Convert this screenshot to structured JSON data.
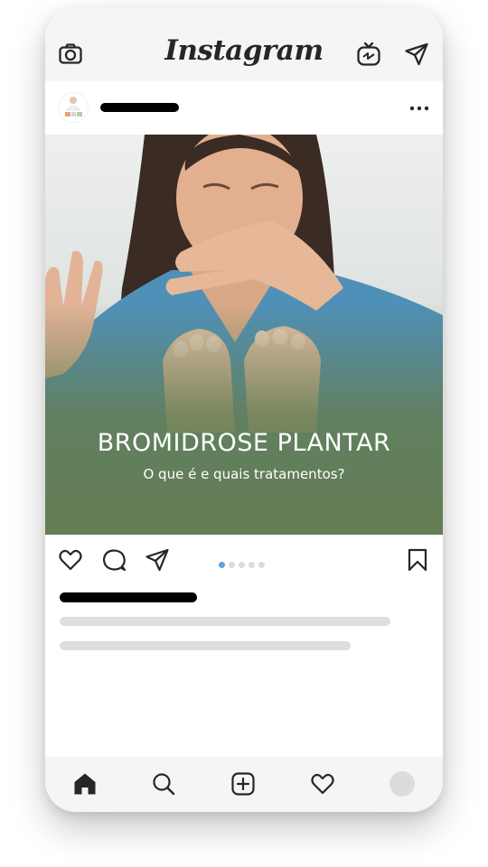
{
  "app": {
    "title": "Instagram",
    "brand_color": "#262626"
  },
  "header_icons": {
    "left": "camera-icon",
    "right": [
      "igtv-icon",
      "direct-message-icon"
    ]
  },
  "post": {
    "title": "BROMIDROSE PLANTAR",
    "subtitle": "O que é e quais tratamentos?",
    "overlay_color": "#647d52",
    "carousel": {
      "total": 5,
      "active": 1,
      "active_color": "#5ea4e0"
    }
  },
  "actions": {
    "left": [
      "heart-icon",
      "comment-icon",
      "share-icon"
    ],
    "right": "bookmark-icon"
  },
  "bottom_nav": {
    "items": [
      "home-icon",
      "search-icon",
      "add-post-icon",
      "activity-icon",
      "profile-avatar"
    ]
  }
}
